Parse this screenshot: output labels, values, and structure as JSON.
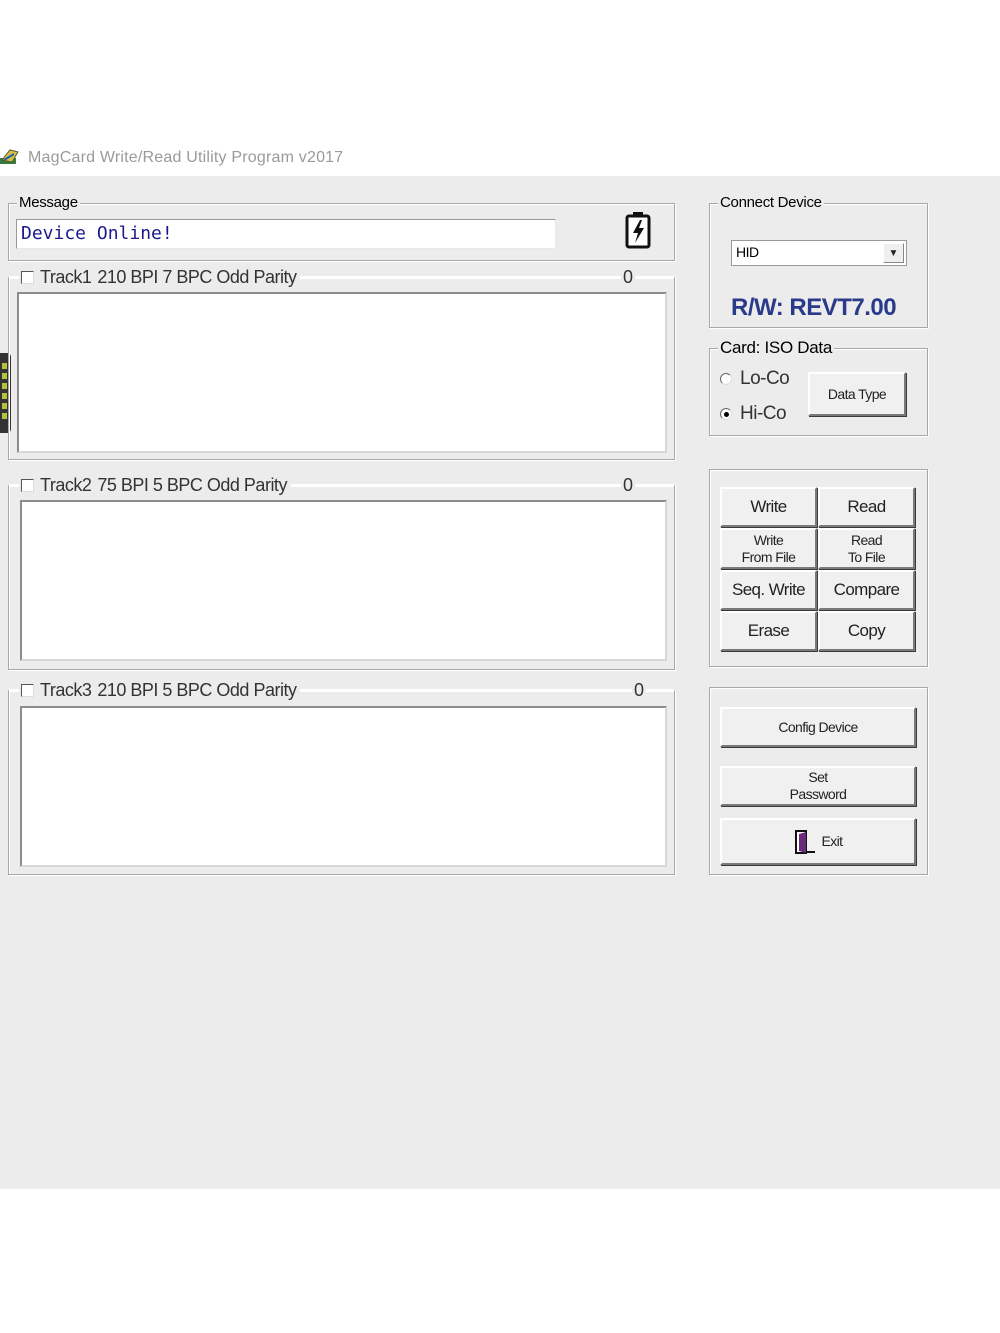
{
  "window": {
    "title": "MagCard Write/Read Utility Program  v2017",
    "icon": "magcard-app-icon"
  },
  "message": {
    "legend": "Message",
    "value": "Device Online!",
    "icon": "battery-icon"
  },
  "tracks": [
    {
      "label": "Track1",
      "spec": "210 BPI  7 BPC  Odd Parity",
      "count": "0",
      "checked": false,
      "data": ""
    },
    {
      "label": "Track2",
      "spec": "75 BPI  5 BPC  Odd Parity",
      "count": "0",
      "checked": false,
      "data": ""
    },
    {
      "label": "Track3",
      "spec": "210 BPI  5 BPC  Odd Parity",
      "count": "0",
      "checked": false,
      "data": ""
    }
  ],
  "device": {
    "legend": "Connect Device",
    "selected": "HID",
    "version": "R/W: REVT7.00"
  },
  "card": {
    "legend": "Card: ISO Data",
    "options": [
      {
        "label": "Lo-Co",
        "selected": false
      },
      {
        "label": "Hi-Co",
        "selected": true
      }
    ],
    "data_type_button": "Data Type"
  },
  "operations": {
    "write": "Write",
    "read": "Read",
    "write_from_file": "Write\nFrom File",
    "read_to_file": "Read\nTo File",
    "seq_write": "Seq. Write",
    "compare": "Compare",
    "erase": "Erase",
    "copy": "Copy"
  },
  "misc": {
    "config_device": "Config Device",
    "set_password": "Set\nPassword",
    "exit": "Exit",
    "exit_icon": "exit-door-icon"
  },
  "colors": {
    "window_bg": "#ececec",
    "version_text": "#2a3a8a",
    "message_text": "#1a1a8c"
  }
}
